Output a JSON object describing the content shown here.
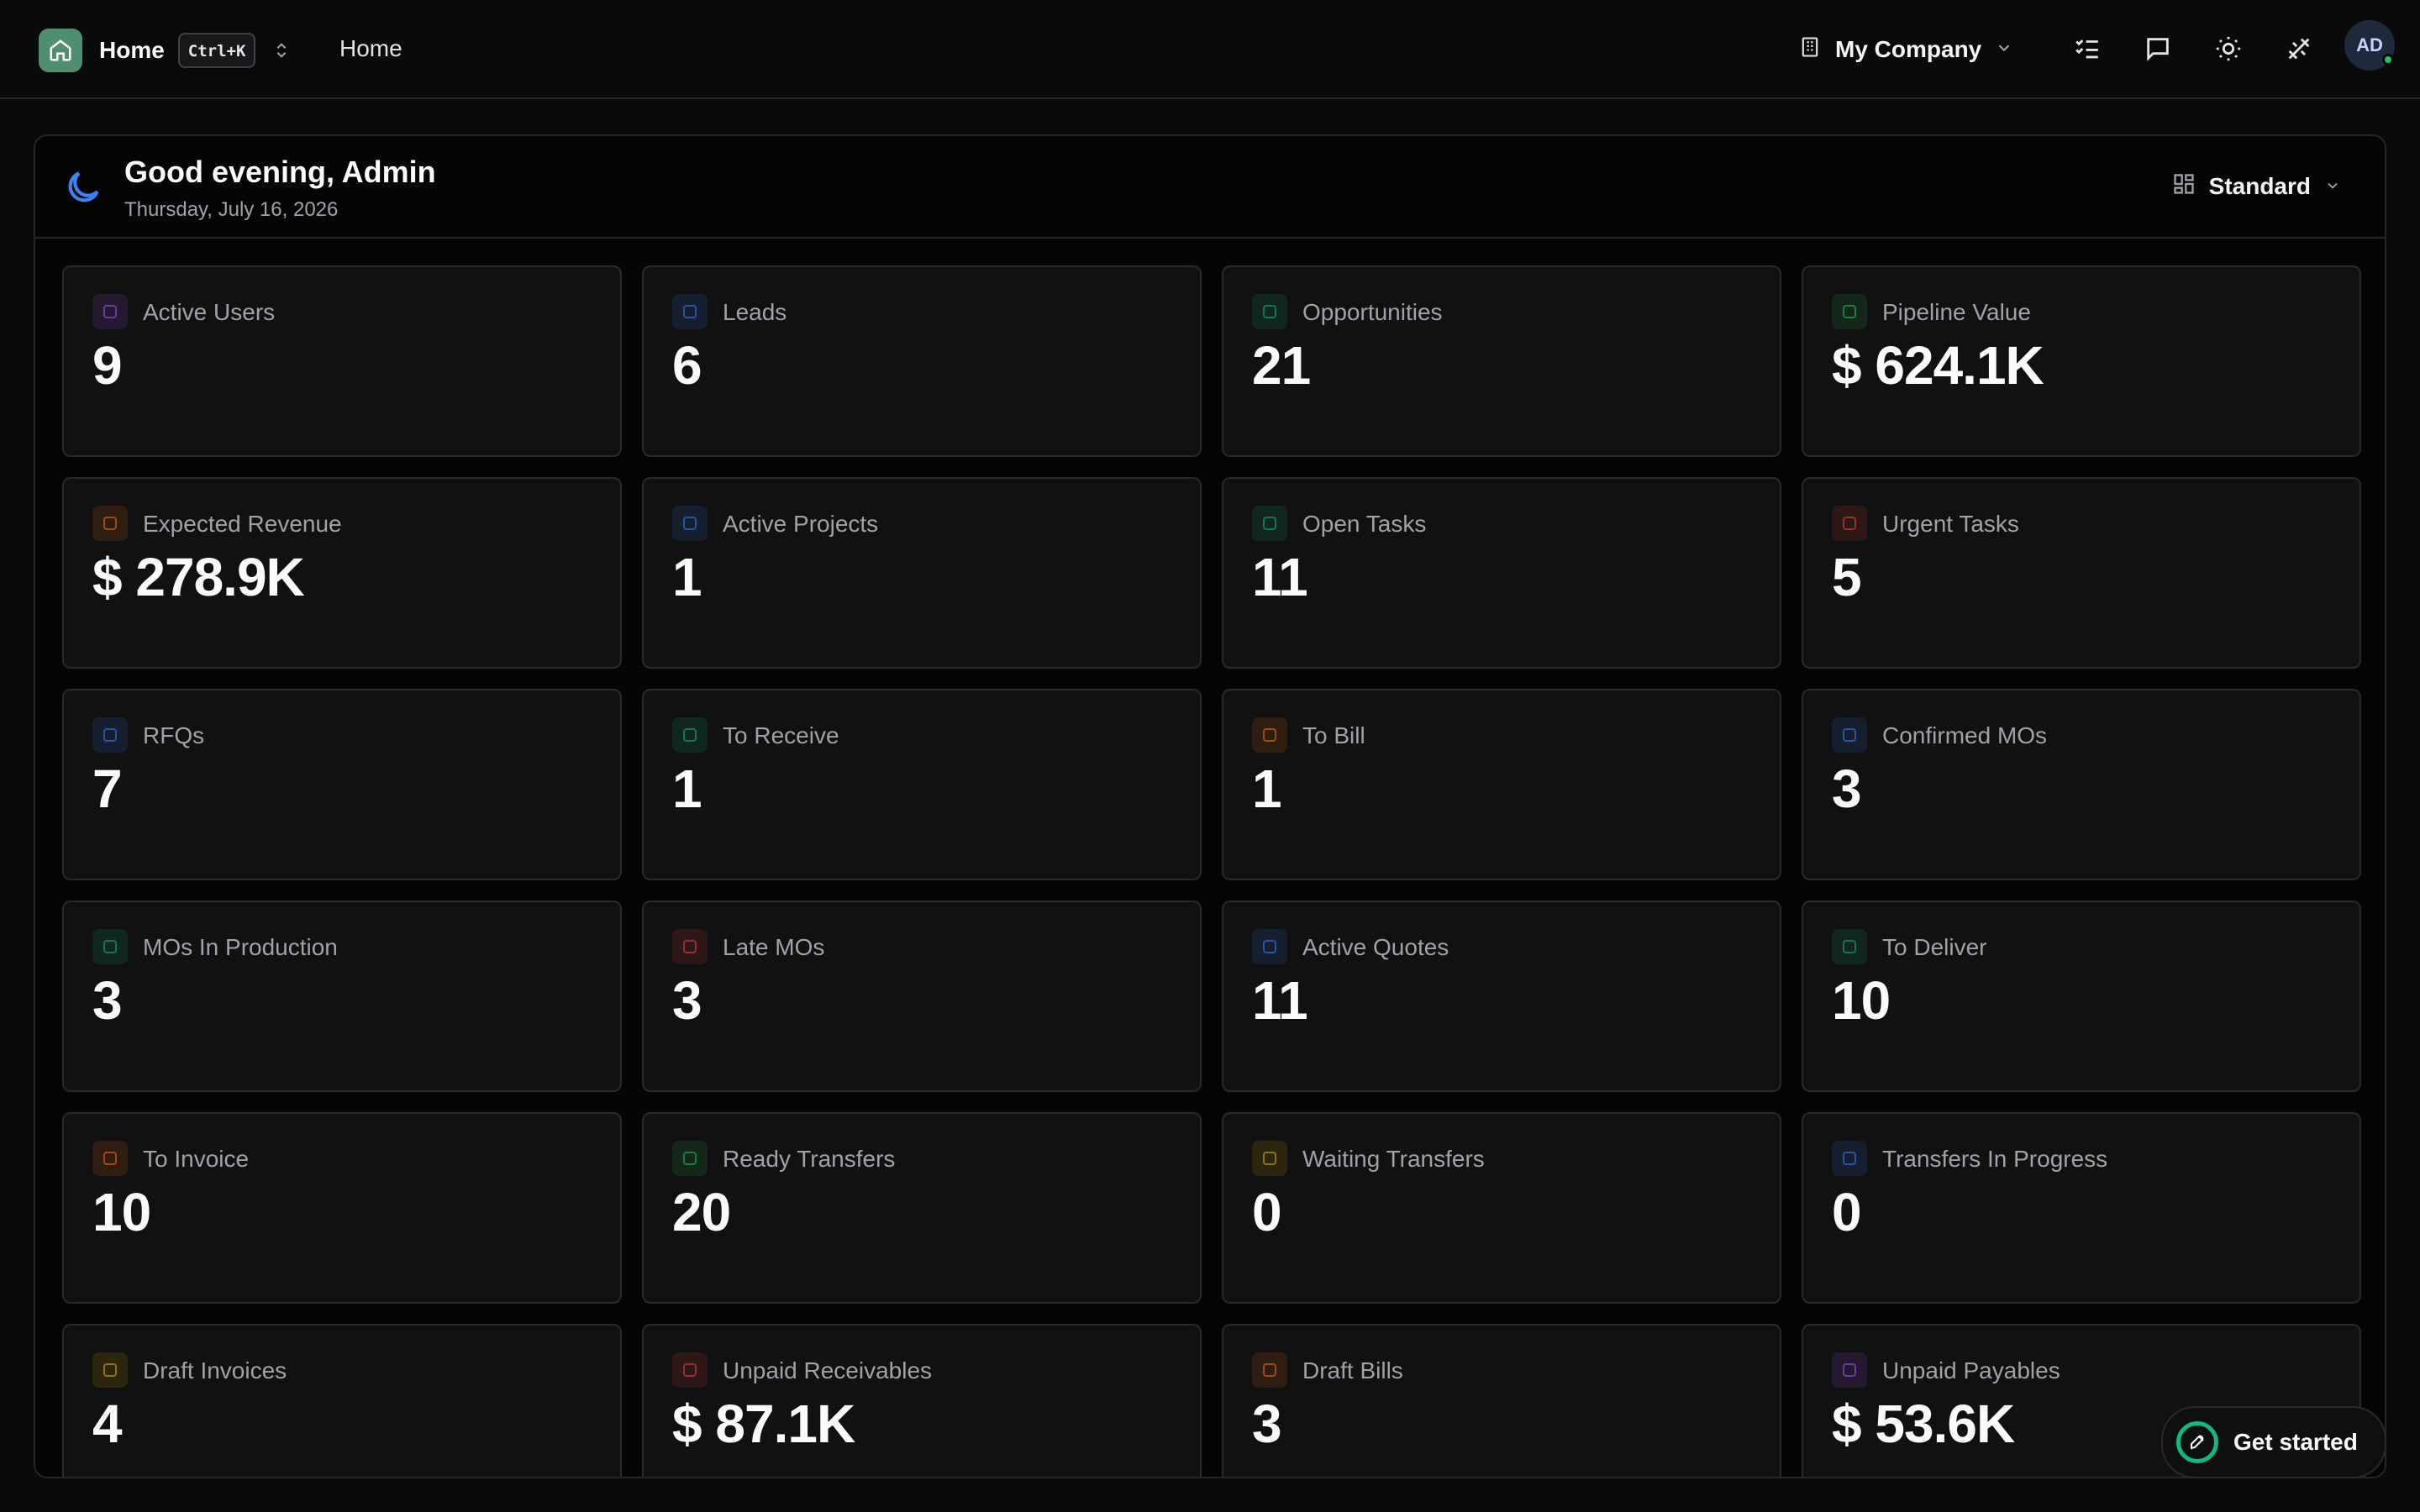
{
  "topbar": {
    "brand": "Home",
    "shortcut": "Ctrl+K",
    "breadcrumb": "Home",
    "company": "My Company",
    "avatar_initials": "AD"
  },
  "header": {
    "greeting": "Good evening, Admin",
    "date": "Thursday, July 16, 2026",
    "layout": "Standard"
  },
  "cards": [
    {
      "label": "Active Users",
      "value": "9",
      "icon": "user-icon",
      "color": "#a855f7"
    },
    {
      "label": "Leads",
      "value": "6",
      "icon": "user-plus-icon",
      "color": "#3b82f6"
    },
    {
      "label": "Opportunities",
      "value": "21",
      "icon": "target-icon",
      "color": "#10b981"
    },
    {
      "label": "Pipeline Value",
      "value": "$ 624.1K",
      "icon": "dollar-icon",
      "color": "#22c55e"
    },
    {
      "label": "Expected Revenue",
      "value": "$ 278.9K",
      "icon": "trending-up-icon",
      "color": "#f97316"
    },
    {
      "label": "Active Projects",
      "value": "1",
      "icon": "folder-icon",
      "color": "#3b82f6"
    },
    {
      "label": "Open Tasks",
      "value": "11",
      "icon": "check-square-icon",
      "color": "#10b981"
    },
    {
      "label": "Urgent Tasks",
      "value": "5",
      "icon": "alert-triangle-icon",
      "color": "#ef4444"
    },
    {
      "label": "RFQs",
      "value": "7",
      "icon": "file-icon",
      "color": "#3b82f6"
    },
    {
      "label": "To Receive",
      "value": "1",
      "icon": "truck-icon",
      "color": "#10b981"
    },
    {
      "label": "To Bill",
      "value": "1",
      "icon": "receipt-icon",
      "color": "#f97316"
    },
    {
      "label": "Confirmed MOs",
      "value": "3",
      "icon": "factory-icon",
      "color": "#3b82f6"
    },
    {
      "label": "MOs In Production",
      "value": "3",
      "icon": "cog-icon",
      "color": "#10b981"
    },
    {
      "label": "Late MOs",
      "value": "3",
      "icon": "clock-alert-icon",
      "color": "#ef4444"
    },
    {
      "label": "Active Quotes",
      "value": "11",
      "icon": "file-text-icon",
      "color": "#3b82f6"
    },
    {
      "label": "To Deliver",
      "value": "10",
      "icon": "cart-icon",
      "color": "#10b981"
    },
    {
      "label": "To Invoice",
      "value": "10",
      "icon": "invoice-icon",
      "color": "#f97316"
    },
    {
      "label": "Ready Transfers",
      "value": "20",
      "icon": "package-icon",
      "color": "#22c55e"
    },
    {
      "label": "Waiting Transfers",
      "value": "0",
      "icon": "clock-icon",
      "color": "#eab308"
    },
    {
      "label": "Transfers In Progress",
      "value": "0",
      "icon": "truck-icon",
      "color": "#3b82f6"
    },
    {
      "label": "Draft Invoices",
      "value": "4",
      "icon": "file-edit-icon",
      "color": "#eab308"
    },
    {
      "label": "Unpaid Receivables",
      "value": "$ 87.1K",
      "icon": "alert-circle-icon",
      "color": "#ef4444"
    },
    {
      "label": "Draft Bills",
      "value": "3",
      "icon": "file-icon",
      "color": "#f97316"
    },
    {
      "label": "Unpaid Payables",
      "value": "$ 53.6K",
      "icon": "receipt-icon",
      "color": "#a855f7"
    }
  ],
  "get_started": "Get started"
}
